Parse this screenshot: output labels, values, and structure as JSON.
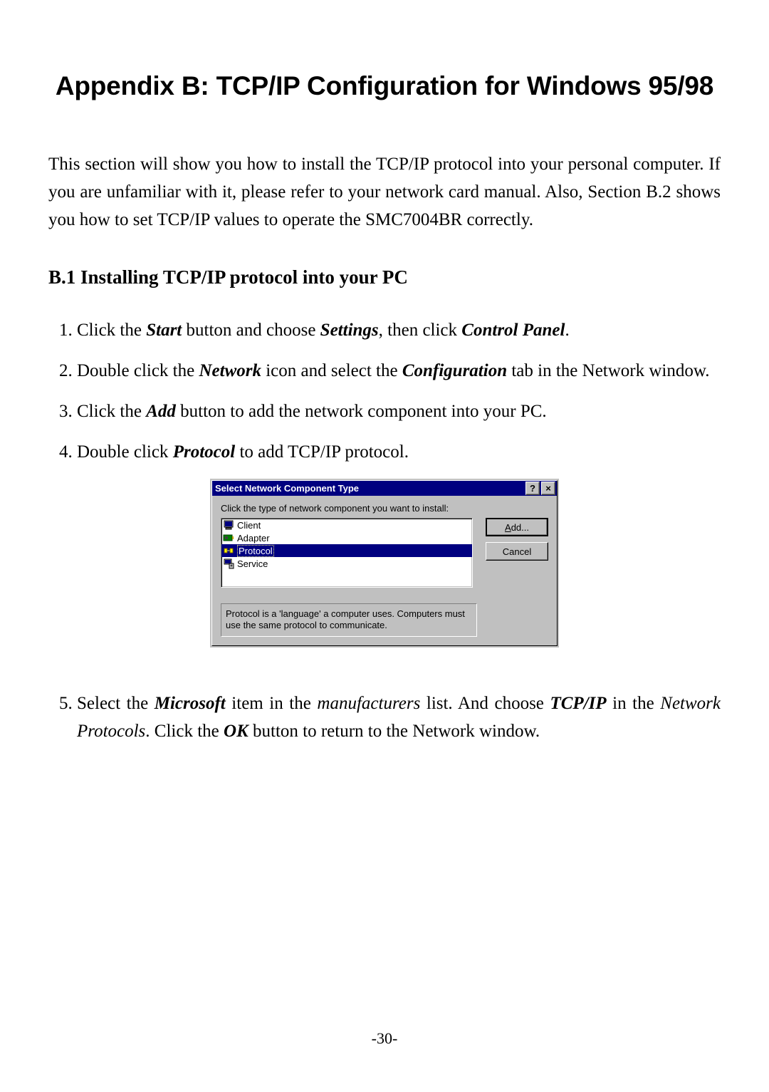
{
  "heading": "Appendix B:  TCP/IP Configuration for Windows 95/98",
  "intro": "This section will show you how to install the TCP/IP protocol into your personal computer. If you are unfamiliar with it, please refer to your network card manual. Also, Section B.2 shows you how to set TCP/IP values to operate the SMC7004BR correctly.",
  "subhead": "B.1 Installing TCP/IP protocol into your PC",
  "step1": {
    "a": "Click the ",
    "b": "Start",
    "c": " button and choose ",
    "d": "Settings",
    "e": ", then click ",
    "f": "Control Panel",
    "g": "."
  },
  "step2": {
    "a": "Double click the ",
    "b": "Network",
    "c": " icon and select the ",
    "d": "Configuration",
    "e": " tab in the Network window."
  },
  "step3": {
    "a": "Click the ",
    "b": "Add",
    "c": " button to add the network component into your PC."
  },
  "step4": {
    "a": "Double click ",
    "b": "Protocol",
    "c": " to add TCP/IP protocol."
  },
  "step5": {
    "a": "Select the ",
    "b": "Microsoft",
    "c": " item in the ",
    "d": "manufacturers",
    "e": " list. And choose ",
    "f": "TCP/IP",
    "g": " in the ",
    "h": "Network Protocols",
    "i": ". Click the ",
    "j": "OK",
    "k": " button to return to the Network window."
  },
  "dialog": {
    "title": "Select Network Component Type",
    "help_glyph": "?",
    "close_glyph": "×",
    "prompt": "Click the type of network component you want to install:",
    "items": [
      {
        "label": "Client",
        "icon": "client-icon",
        "selected": false
      },
      {
        "label": "Adapter",
        "icon": "adapter-icon",
        "selected": false
      },
      {
        "label": "Protocol",
        "icon": "protocol-icon",
        "selected": true
      },
      {
        "label": "Service",
        "icon": "service-icon",
        "selected": false
      }
    ],
    "add_access": "A",
    "add_rest": "dd...",
    "cancel_label": "Cancel",
    "description": "Protocol is a 'language' a computer uses. Computers must use the same protocol to communicate."
  },
  "page_number": "-30-"
}
